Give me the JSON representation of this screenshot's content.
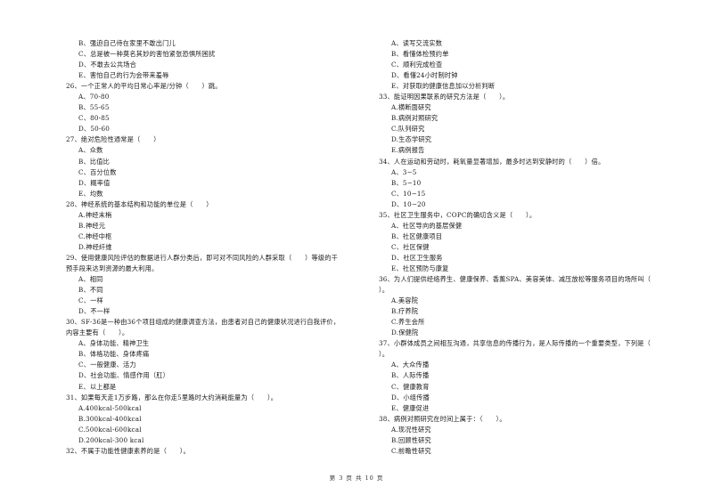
{
  "left_column": [
    {
      "type": "opt",
      "text": "B、强迫自己待在家里不敢出门儿"
    },
    {
      "type": "opt",
      "text": "C、总是被一种莫名其妙的害怕紧张恐惧所困扰"
    },
    {
      "type": "opt",
      "text": "D、不敢去公共场合"
    },
    {
      "type": "opt",
      "text": "E、害怕自己的行为会带来羞辱"
    },
    {
      "type": "q",
      "text": "26、一个正常人的平均日常心率是/分钟（　　）跳。"
    },
    {
      "type": "opt",
      "text": "A、70-80"
    },
    {
      "type": "opt",
      "text": "B、55-65"
    },
    {
      "type": "opt",
      "text": "C、80-85"
    },
    {
      "type": "opt",
      "text": "D、50-60"
    },
    {
      "type": "q",
      "text": "27、绝对危险性通常是（　　）"
    },
    {
      "type": "opt",
      "text": "A、众数"
    },
    {
      "type": "opt",
      "text": "B、比值比"
    },
    {
      "type": "opt",
      "text": "C、百分位数"
    },
    {
      "type": "opt",
      "text": "D、概率值"
    },
    {
      "type": "opt",
      "text": "E、均数"
    },
    {
      "type": "q",
      "text": "28、神经系统的基本结构和功能的单位是（　　）"
    },
    {
      "type": "opt",
      "text": "A.神经末梢"
    },
    {
      "type": "opt",
      "text": "B.神经元"
    },
    {
      "type": "opt",
      "text": "C.神经中枢"
    },
    {
      "type": "opt",
      "text": "D.神经纤维"
    },
    {
      "type": "q",
      "text": "29、使用健康风险评估的数据进行人群分类后，即可对不同风险的人群采取（　　）等级的干"
    },
    {
      "type": "q",
      "text": "预手段来达到资源的最大利用。"
    },
    {
      "type": "opt",
      "text": "A、相同"
    },
    {
      "type": "opt",
      "text": "B、不同"
    },
    {
      "type": "opt",
      "text": "C、一样"
    },
    {
      "type": "opt",
      "text": "D、不一样"
    },
    {
      "type": "q",
      "text": "30、SF-36是一种由36个项目组成的健康调查方法，由患者对自己的健康状况进行自我评价，"
    },
    {
      "type": "q",
      "text": "内容主要有（　　）。"
    },
    {
      "type": "opt",
      "text": "A、身体功能、精神卫生"
    },
    {
      "type": "opt",
      "text": "B、体格功能、身体疼痛"
    },
    {
      "type": "opt",
      "text": "C、一般健康、活力"
    },
    {
      "type": "opt",
      "text": "D、社会功能、情感作用（肛）"
    },
    {
      "type": "opt",
      "text": "E、以上都是"
    },
    {
      "type": "q",
      "text": "31、如果每天走1万步路，那么在你走5里路时大约消耗能量为（　　）。"
    },
    {
      "type": "opt",
      "text": "A.400kcal-500kcal"
    },
    {
      "type": "opt",
      "text": "B.300kcal-400kcal"
    },
    {
      "type": "opt",
      "text": "C.500kcal-600kcal"
    },
    {
      "type": "opt",
      "text": "D.200kcal-300 kcal"
    },
    {
      "type": "q",
      "text": "32、不属于功能性健康素养的是（　　）。"
    }
  ],
  "right_column": [
    {
      "type": "opt",
      "text": "A、读写交流实数"
    },
    {
      "type": "opt",
      "text": "B、看懂体检预约单"
    },
    {
      "type": "opt",
      "text": "C、顺利完成检查"
    },
    {
      "type": "opt",
      "text": "D、看懂24小时制时钟"
    },
    {
      "type": "opt",
      "text": "E、对获取的健康信息加以分析判断"
    },
    {
      "type": "q",
      "text": "33、能证明因果联系的研究方法是（　　）。"
    },
    {
      "type": "opt",
      "text": "A.横断面研究"
    },
    {
      "type": "opt",
      "text": "B.病例对照研究"
    },
    {
      "type": "opt",
      "text": "C.队列研究"
    },
    {
      "type": "opt",
      "text": "D.生态学研究"
    },
    {
      "type": "opt",
      "text": "E.病例报告"
    },
    {
      "type": "q",
      "text": "34、人在运动和劳动时，耗氧量显著增加，最多时达到安静时的（　　）倍。"
    },
    {
      "type": "opt",
      "text": "A、3−5"
    },
    {
      "type": "opt",
      "text": "B、5−10"
    },
    {
      "type": "opt",
      "text": "C、10−15"
    },
    {
      "type": "opt",
      "text": "D、10−20"
    },
    {
      "type": "q",
      "text": "35、社区卫生服务中，COPC的确切含义是（　　）。"
    },
    {
      "type": "opt",
      "text": "A、社区导向的基层保健"
    },
    {
      "type": "opt",
      "text": "B、社区健康项目"
    },
    {
      "type": "opt",
      "text": "C、社区保健"
    },
    {
      "type": "opt",
      "text": "D、社区卫生服务"
    },
    {
      "type": "opt",
      "text": "E、社区预防与康复"
    },
    {
      "type": "q",
      "text": "36、为人们提供经络养生、健康保养、香薰SPA、美容美体、减压放松等服务项目的场所叫（"
    },
    {
      "type": "q",
      "text": "）。"
    },
    {
      "type": "opt",
      "text": "A.美容院"
    },
    {
      "type": "opt",
      "text": "B.疗养院"
    },
    {
      "type": "opt",
      "text": "C.养生会所"
    },
    {
      "type": "opt",
      "text": "D.保健院"
    },
    {
      "type": "q",
      "text": "37、小群体成员之间相互沟通，共享信息的传播行为，是人际传播的一个重要类型，下列是（"
    },
    {
      "type": "q",
      "text": "）。"
    },
    {
      "type": "opt",
      "text": "A、大众传播"
    },
    {
      "type": "opt",
      "text": "B、人际传播"
    },
    {
      "type": "opt",
      "text": "C、健康教育"
    },
    {
      "type": "opt",
      "text": "D、小组传播"
    },
    {
      "type": "opt",
      "text": "E、健康促进"
    },
    {
      "type": "q",
      "text": "38、病例对照研究在时间上属于：（　　）。"
    },
    {
      "type": "opt",
      "text": "A.现况性研究"
    },
    {
      "type": "opt",
      "text": "B.回顾性研究"
    },
    {
      "type": "opt",
      "text": "C.前瞻性研究"
    }
  ],
  "footer": {
    "page_label": "第 3 页 共 10 页"
  }
}
